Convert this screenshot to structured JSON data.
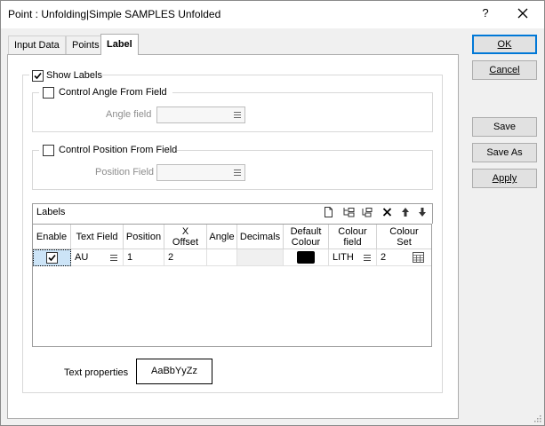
{
  "window": {
    "title": "Point : Unfolding|Simple SAMPLES Unfolded",
    "help_label": "?"
  },
  "tabs": [
    {
      "label": "Input Data",
      "active": false
    },
    {
      "label": "Points",
      "active": false
    },
    {
      "label": "Label",
      "active": true
    }
  ],
  "show_labels": {
    "label": "Show Labels",
    "checked": true
  },
  "angle_group": {
    "label": "Control Angle From Field",
    "checked": false,
    "field_label": "Angle field",
    "field_value": ""
  },
  "position_group": {
    "label": "Control Position From Field",
    "checked": false,
    "field_label": "Position Field",
    "field_value": ""
  },
  "labels_grid": {
    "title": "Labels",
    "toolbar_icons": [
      "new-row-icon",
      "insert-row-icon",
      "insert-row-after-icon",
      "delete-row-icon",
      "move-up-icon",
      "move-down-icon"
    ],
    "columns": {
      "enable": "Enable",
      "text_field": "Text Field",
      "position": "Position",
      "x_offset_1": "X",
      "x_offset_2": "Offset",
      "angle": "Angle",
      "decimals": "Decimals",
      "default_colour_1": "Default",
      "default_colour_2": "Colour",
      "colour_field_1": "Colour",
      "colour_field_2": "field",
      "colour_set_1": "Colour",
      "colour_set_2": "Set"
    },
    "rows": [
      {
        "enable": true,
        "text_field": "AU",
        "position": "1",
        "x_offset": "2",
        "angle": "",
        "decimals": "",
        "default_colour": "#000000",
        "colour_field": "LITH",
        "colour_set": "2"
      }
    ]
  },
  "text_properties": {
    "label": "Text properties",
    "sample": "AaBbYyZz"
  },
  "buttons": {
    "ok": "OK",
    "cancel": "Cancel",
    "save": "Save",
    "save_as": "Save As",
    "apply": "Apply"
  },
  "colors": {
    "accent": "#0078d7",
    "default_colour_swatch": "#000000"
  }
}
